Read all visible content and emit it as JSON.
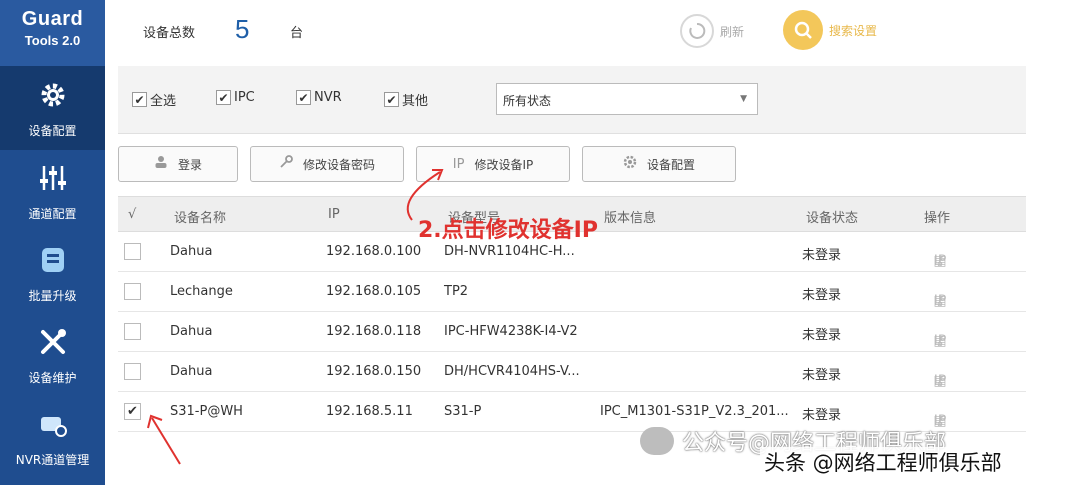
{
  "sidebar": {
    "logo_line1": "Guard",
    "logo_line2": "Tools 2.0",
    "items": [
      {
        "label": "设备配置",
        "icon": "gear-icon"
      },
      {
        "label": "通道配置",
        "icon": "sliders-icon"
      },
      {
        "label": "批量升级",
        "icon": "upgrade-icon"
      },
      {
        "label": "设备维护",
        "icon": "tools-icon"
      },
      {
        "label": "NVR通道管理",
        "icon": "nvr-channel-icon"
      }
    ]
  },
  "header": {
    "device_total_label": "设备总数",
    "device_count": "5",
    "unit": "台",
    "refresh_label": "刷新",
    "search_label": "搜索设置"
  },
  "filters": {
    "select_all": "全选",
    "ipc": "IPC",
    "nvr": "NVR",
    "other": "其他",
    "status_select": "所有状态"
  },
  "actions": {
    "login": "登录",
    "modify_password": "修改设备密码",
    "modify_ip_prefix": "IP",
    "modify_ip": "修改设备IP",
    "device_config": "设备配置"
  },
  "table": {
    "headers": {
      "check": "√",
      "name": "设备名称",
      "ip": "IP",
      "model": "设备型号",
      "version": "版本信息",
      "status": "设备状态",
      "ops": "操作"
    },
    "rows": [
      {
        "checked": false,
        "name": "Dahua",
        "ip": "192.168.0.100",
        "model": "DH-NVR1104HC-H...",
        "version": "",
        "status": "未登录"
      },
      {
        "checked": false,
        "name": "Lechange",
        "ip": "192.168.0.105",
        "model": "TP2",
        "version": "",
        "status": "未登录"
      },
      {
        "checked": false,
        "name": "Dahua",
        "ip": "192.168.0.118",
        "model": "IPC-HFW4238K-I4-V2",
        "version": "",
        "status": "未登录"
      },
      {
        "checked": false,
        "name": "Dahua",
        "ip": "192.168.0.150",
        "model": "DH/HCVR4104HS-V...",
        "version": "",
        "status": "未登录"
      },
      {
        "checked": true,
        "name": "S31-P@WH",
        "ip": "192.168.5.11",
        "model": "S31-P",
        "version": "IPC_M1301-S31P_V2.3_201...",
        "status": "未登录"
      }
    ],
    "op_ip_label": "IP"
  },
  "annotation": "2.点击修改设备IP",
  "watermark": {
    "line1": "公众号@网络工程师俱乐部",
    "line2": "头条 @网络工程师俱乐部"
  },
  "colors": {
    "sidebar": "#1f4d8f",
    "accent_count": "#1f5fa8",
    "annotation": "#e0322f",
    "search_button": "#f3c75a"
  }
}
